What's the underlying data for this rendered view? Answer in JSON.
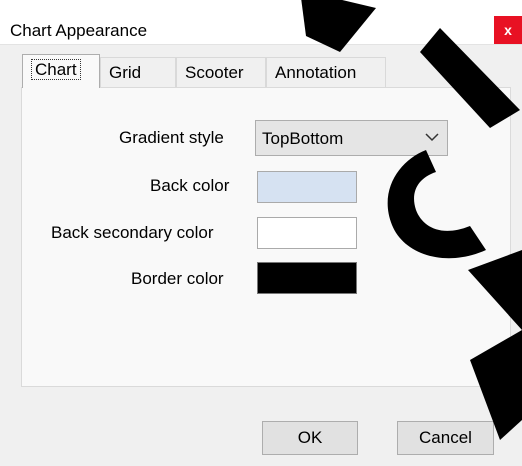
{
  "window": {
    "title": "Chart Appearance",
    "close_glyph": "x"
  },
  "tabs": [
    {
      "label": "Chart",
      "active": true
    },
    {
      "label": "Grid",
      "active": false
    },
    {
      "label": "Scooter",
      "active": false
    },
    {
      "label": "Annotation",
      "active": false
    }
  ],
  "form": {
    "gradient_style": {
      "label": "Gradient style",
      "value": "TopBottom"
    },
    "back_color": {
      "label": "Back color",
      "color": "#d6e2f2"
    },
    "back_secondary_color": {
      "label": "Back secondary color",
      "color": "#ffffff"
    },
    "border_color": {
      "label": "Border color",
      "color": "#000000"
    }
  },
  "buttons": {
    "ok": "OK",
    "cancel": "Cancel"
  }
}
